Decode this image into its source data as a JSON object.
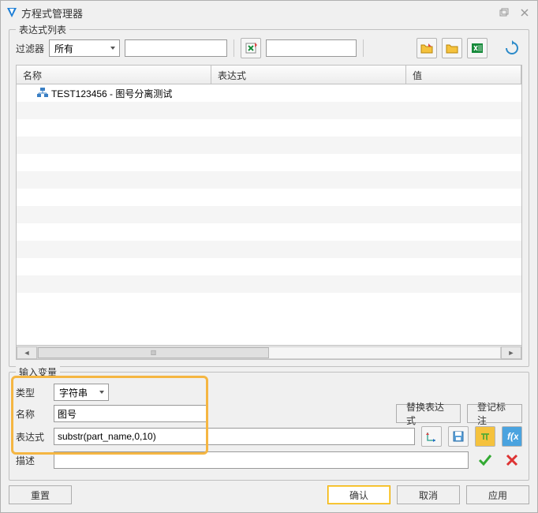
{
  "window": {
    "title": "方程式管理器"
  },
  "group_list": {
    "title": "表达式列表",
    "filter_label": "过滤器",
    "filter_value": "所有",
    "columns": {
      "name": "名称",
      "expr": "表达式",
      "value": "值"
    },
    "rows": [
      {
        "name": "TEST123456 - 图号分离测试",
        "expr": "",
        "value": ""
      }
    ]
  },
  "group_input": {
    "title": "输入变量",
    "type_label": "类型",
    "type_value": "字符串",
    "name_label": "名称",
    "name_value": "图号",
    "expr_label": "表达式",
    "expr_value": "substr(part_name,0,10)",
    "desc_label": "描述",
    "desc_value": "",
    "btn_replace": "替换表达式",
    "btn_register": "登记标注"
  },
  "footer": {
    "reset": "重置",
    "ok": "确认",
    "cancel": "取消",
    "apply": "应用"
  }
}
